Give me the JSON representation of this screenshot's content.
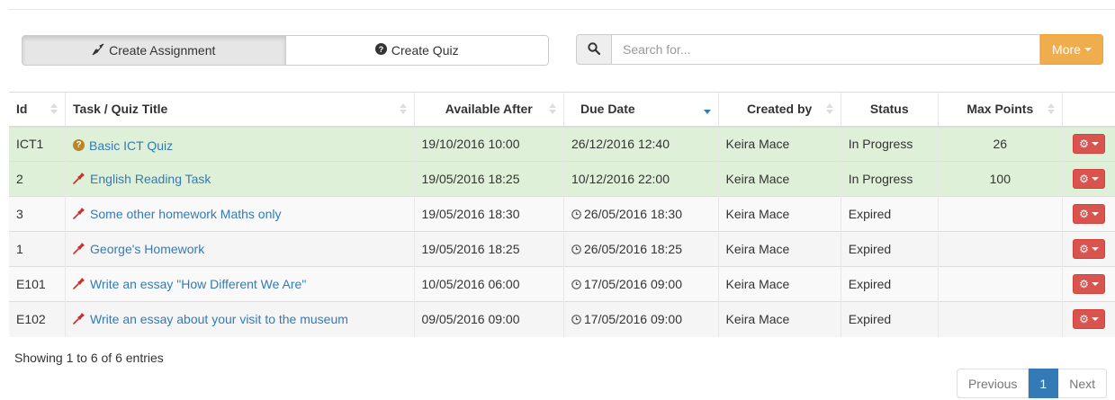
{
  "toolbar": {
    "create_assignment": "Create Assignment",
    "create_quiz": "Create Quiz"
  },
  "search": {
    "placeholder": "Search for...",
    "more_label": "More"
  },
  "table": {
    "columns": [
      "Id",
      "Task / Quiz Title",
      "Available After",
      "Due Date",
      "Created by",
      "Status",
      "Max Points"
    ],
    "sorted_column": "Due Date",
    "sort_direction": "descending",
    "rows": [
      {
        "id": "ICT1",
        "type": "quiz",
        "title": "Basic ICT Quiz",
        "available_after": "19/10/2016 10:00",
        "due_date": "26/12/2016 12:40",
        "due_icon": "",
        "created_by": "Keira Mace",
        "status": "In Progress",
        "max_points": "26"
      },
      {
        "id": "2",
        "type": "assignment",
        "title": "English Reading Task",
        "available_after": "19/05/2016 18:25",
        "due_date": "10/12/2016 22:00",
        "due_icon": "",
        "created_by": "Keira Mace",
        "status": "In Progress",
        "max_points": "100"
      },
      {
        "id": "3",
        "type": "assignment",
        "title": "Some other homework Maths only",
        "available_after": "19/05/2016 18:30",
        "due_date": "26/05/2016 18:30",
        "due_icon": "clock",
        "created_by": "Keira Mace",
        "status": "Expired",
        "max_points": ""
      },
      {
        "id": "1",
        "type": "assignment",
        "title": "George's Homework",
        "available_after": "19/05/2016 18:25",
        "due_date": "26/05/2016 18:25",
        "due_icon": "clock",
        "created_by": "Keira Mace",
        "status": "Expired",
        "max_points": ""
      },
      {
        "id": "E101",
        "type": "assignment",
        "title": "Write an essay \"How Different We Are\"",
        "available_after": "10/05/2016 06:00",
        "due_date": "17/05/2016 09:00",
        "due_icon": "clock",
        "created_by": "Keira Mace",
        "status": "Expired",
        "max_points": ""
      },
      {
        "id": "E102",
        "type": "assignment",
        "title": "Write an essay about your visit to the museum",
        "available_after": "09/05/2016 09:00",
        "due_date": "17/05/2016 09:00",
        "due_icon": "clock",
        "created_by": "Keira Mace",
        "status": "Expired",
        "max_points": ""
      }
    ]
  },
  "footer": {
    "info": "Showing 1 to 6 of 6 entries",
    "previous": "Previous",
    "page": "1",
    "next": "Next"
  },
  "colors": {
    "in_progress_row": "#dff0d8",
    "link": "#337ab7",
    "more_button": "#f0ad4e",
    "action_button": "#d9534f",
    "active_page": "#337ab7"
  }
}
